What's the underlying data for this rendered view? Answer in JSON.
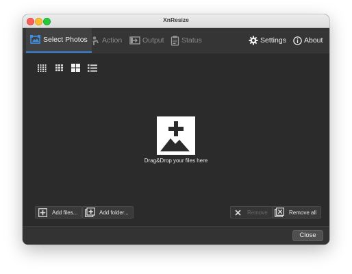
{
  "window": {
    "title": "XnResize"
  },
  "tabs": [
    {
      "label": "Select Photos",
      "icon": "select-photos-icon",
      "active": true
    },
    {
      "label": "Action",
      "icon": "action-icon",
      "active": false
    },
    {
      "label": "Output",
      "icon": "output-icon",
      "active": false
    },
    {
      "label": "Status",
      "icon": "status-icon",
      "active": false
    }
  ],
  "toolbar_right": {
    "settings_label": "Settings",
    "about_label": "About"
  },
  "view_modes": [
    "large-grid-view-icon",
    "medium-grid-view-icon",
    "small-grid-view-icon",
    "list-view-icon"
  ],
  "dropzone": {
    "label": "Drag&Drop your files here",
    "icon": "add-image-icon"
  },
  "actions": {
    "add_files": "Add files...",
    "add_folder": "Add folder...",
    "remove": "Remove",
    "remove_all": "Remove all"
  },
  "footer": {
    "close": "Close"
  },
  "colors": {
    "accent": "#2f86e4",
    "background": "#2b2b2b",
    "toolbar": "#353535"
  }
}
